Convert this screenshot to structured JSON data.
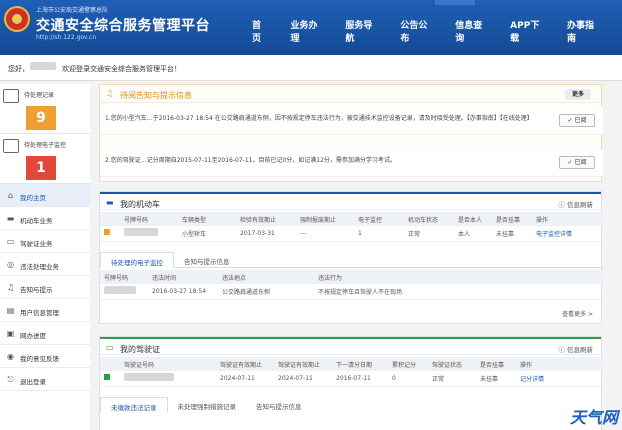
{
  "header": {
    "org": "上海市公安局交通警察总队",
    "title": "交通安全综合服务管理平台",
    "url": "http://sh.122.gov.cn",
    "nav": [
      "首页",
      "业务办理",
      "服务导航",
      "公告公布",
      "信息查询",
      "APP下载",
      "办事指南"
    ]
  },
  "welcome": {
    "prefix": "您好，",
    "message": "欢迎登录交通安全综合服务管理平台！"
  },
  "sidebar": {
    "cards": [
      {
        "label": "待处理记录",
        "count": "9",
        "color": "#f0a030"
      },
      {
        "label": "待处理电子监控",
        "count": "1",
        "color": "#e0483a"
      }
    ],
    "items": [
      {
        "label": "我的主页",
        "icon": "home-icon",
        "glyph": "⌂"
      },
      {
        "label": "机动车业务",
        "icon": "car-icon",
        "glyph": "▬"
      },
      {
        "label": "驾驶证业务",
        "icon": "license-icon",
        "glyph": "▭"
      },
      {
        "label": "违法处理业务",
        "icon": "violation-icon",
        "glyph": "◎"
      },
      {
        "label": "告知与提示",
        "icon": "bell-icon",
        "glyph": "♫"
      },
      {
        "label": "用户信息管理",
        "icon": "user-icon",
        "glyph": "▤"
      },
      {
        "label": "网办进度",
        "icon": "progress-icon",
        "glyph": "▣"
      },
      {
        "label": "我的意见反馈",
        "icon": "feedback-icon",
        "glyph": "◉"
      },
      {
        "label": "退出登录",
        "icon": "logout-icon",
        "glyph": "⎋"
      }
    ]
  },
  "notices": {
    "title": "待阅告知与提示信息",
    "more": "更多",
    "items": [
      {
        "text": "1.您的小型汽车…于2016-03-27 18:54 在公交路肩通道东侧，因不按规定停车违法行为，被交通技术监控设备记录，请及时接受处理。【办事指南】【在线处理】",
        "button": "✓ 已阅"
      },
      {
        "text": "2.您的驾驶证…记分周期自2015-07-11至2016-07-11，目前已记0分，如记满12分，需参加满分学习考试。",
        "button": "✓ 已阅"
      }
    ]
  },
  "vehicles": {
    "title": "我的机动车",
    "refresh": "信息刷新",
    "headers": [
      "号牌号码",
      "车辆类型",
      "检验有效期止",
      "强制报废期止",
      "电子监控",
      "机动车状态",
      "是否本人",
      "是否挂靠",
      "操作"
    ],
    "rows": [
      [
        "小型轿车",
        "2017-03-31",
        "---",
        "1",
        "正常",
        "本人",
        "未挂靠",
        "电子监控详情"
      ]
    ],
    "tabs": [
      "待处理的电子监控",
      "告知与提示信息"
    ],
    "sub_headers": [
      "号牌号码",
      "违法时间",
      "违法地点",
      "违法行为"
    ],
    "sub_rows": [
      [
        "2016-03-27 18:54",
        "公交路肩通道东侧",
        "不按规定停车且驾驶人不在现场"
      ]
    ],
    "view_more": "查看更多 >"
  },
  "license": {
    "title": "我的驾驶证",
    "refresh": "信息刷新",
    "headers": [
      "驾驶证号码",
      "",
      "驾驶证有效期止",
      "驾驶证有效期止",
      "下一清分日期",
      "累积记分",
      "驾驶证状态",
      "是否挂靠",
      "操作"
    ],
    "rows": [
      [
        "2024-07-11",
        "2024-07-11",
        "2016-07-11",
        "0",
        "正常",
        "未挂靠",
        "记分详情"
      ]
    ],
    "tabs": [
      "未缴款违法记录",
      "未处理强制措施记录",
      "告知与提示信息"
    ]
  },
  "watermark": "天气网"
}
